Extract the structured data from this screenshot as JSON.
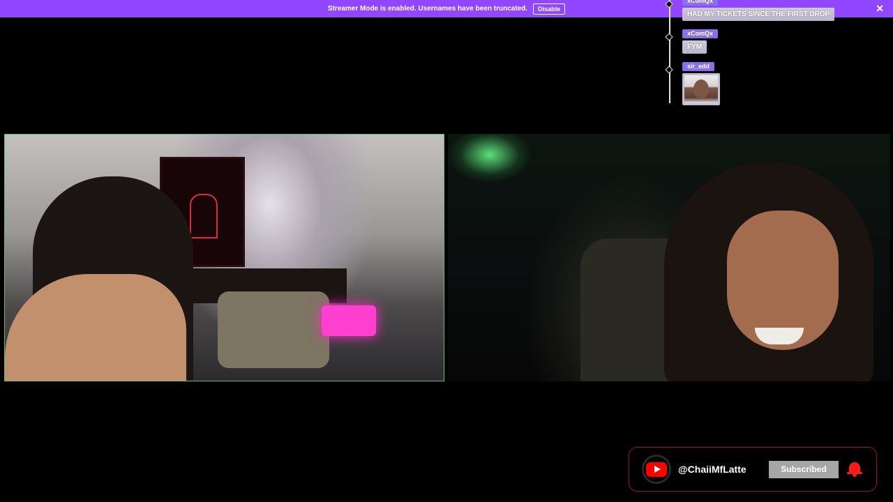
{
  "banner": {
    "message": "Streamer Mode is enabled. Usernames have been truncated.",
    "disable_label": "Disable",
    "close_glyph": "✕",
    "color": "#9147ff"
  },
  "chat": {
    "messages": [
      {
        "user": "xComQx",
        "text": "HAD MY TICKETS SINCE THE FIRST DROP"
      },
      {
        "user": "xComQx",
        "text": "FYM"
      },
      {
        "user": "sir_edd",
        "emote": "face-emote"
      }
    ]
  },
  "videos": [
    {
      "name": "left-webcam",
      "border_color": "#5fbf7a"
    },
    {
      "name": "right-webcam"
    }
  ],
  "subscribe": {
    "icon": "youtube-icon",
    "handle": "@ChaiiMfLatte",
    "button_label": "Subscribed",
    "bell_icon": "bell-icon",
    "accent": "#ff0000"
  }
}
